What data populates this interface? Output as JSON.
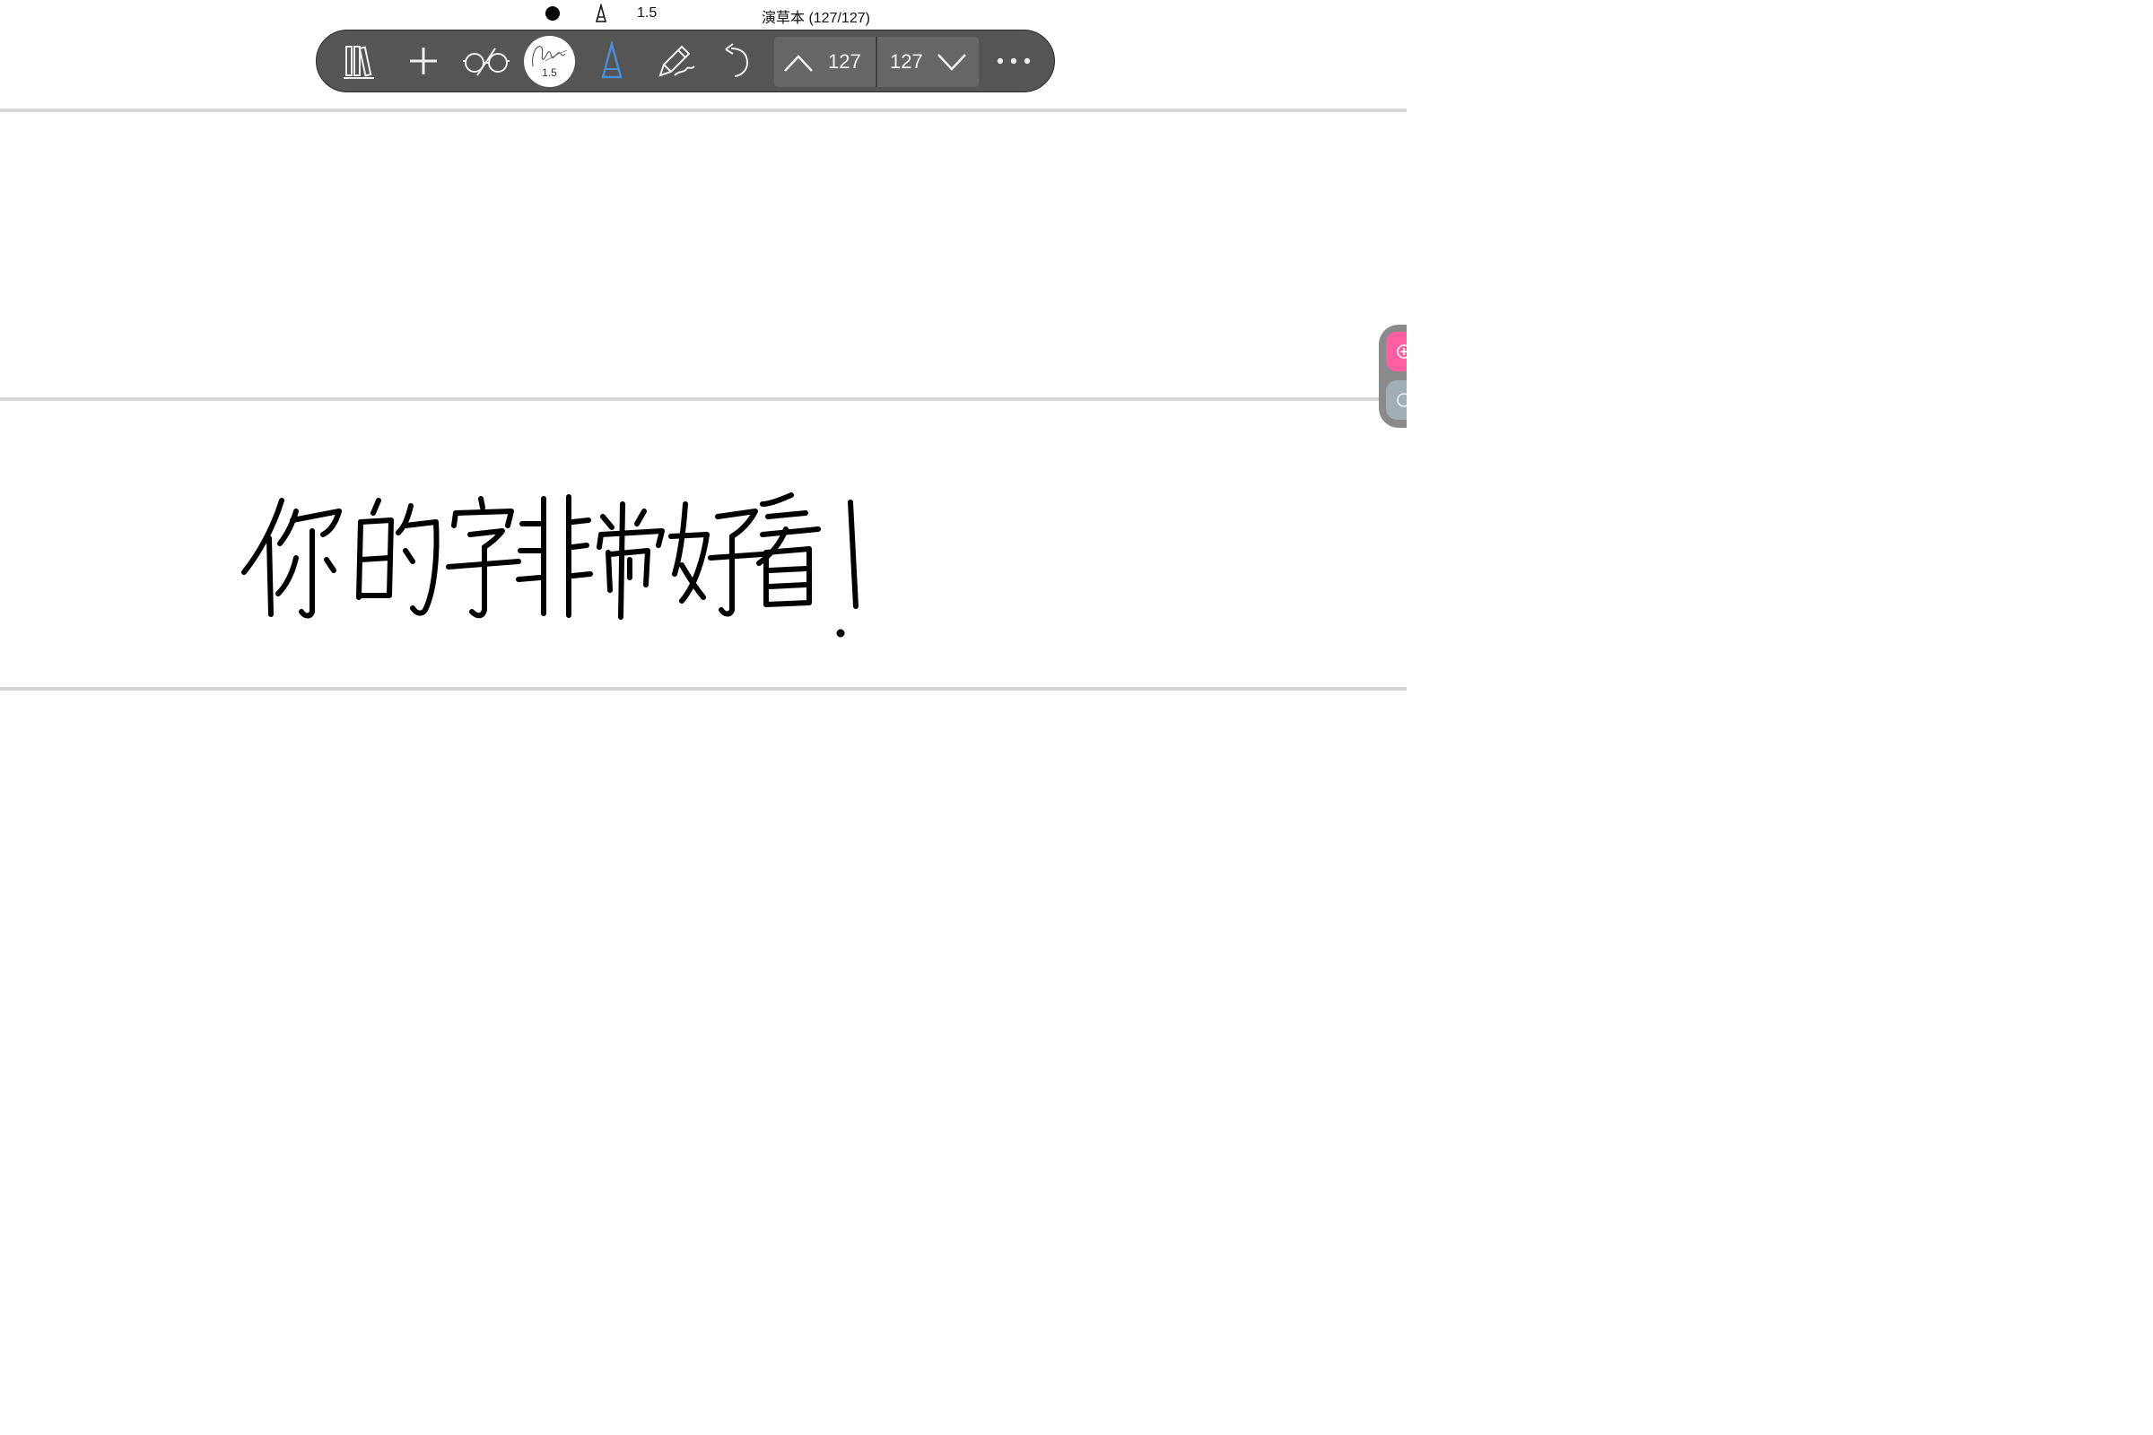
{
  "status": {
    "stroke_width": "1.5",
    "document_title": "演草本 (127/127)"
  },
  "toolbar": {
    "brush_size": "1.5",
    "page_up_number": "127",
    "page_down_number": "127"
  },
  "canvas": {
    "handwritten_text": "你的字非常好看！"
  },
  "colors": {
    "toolbar_bg": "#555555",
    "pen_active": "#4a90d9",
    "side_pink": "#ff5fa2",
    "side_gray": "#a2aeb6"
  }
}
